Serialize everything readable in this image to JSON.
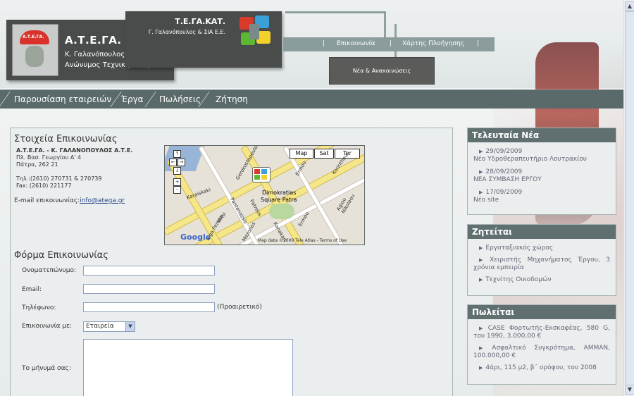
{
  "header": {
    "logo_helmet": "Α.Τ.Ε.ΓΑ.",
    "logo_title": "Α.Τ.Ε.ΓΑ.",
    "logo_sub1": "Κ. Γαλανόπουλος Α.Τ.Ε.",
    "logo_sub2": "Ανώνυμος Τεχνική Εταιρεία",
    "tega_title": "Τ.Ε.ΓΑ.ΚΑΤ.",
    "tega_sub": "Γ. Γαλανόπουλος & ΣΙΑ Ε.Ε.",
    "topnav": [
      "|",
      "Επικοινωνία",
      "|",
      "Χάρτης Πλοήγησης",
      "|"
    ],
    "news_button": "Νέα & Ανακοινώσεις"
  },
  "mainnav": [
    "Παρουσίαση εταιρειών",
    "Έργα",
    "Πωλήσεις",
    "Ζήτηση"
  ],
  "contact": {
    "heading": "Στοιχεία Επικοινωνίας",
    "company": "Α.Τ.Ε.ΓΑ. - Κ. ΓΑΛΑΝΟΠΟΥΛΟΣ Α.Τ.Ε.",
    "address1": "Πλ. Βασ. Γεωργίου Α' 4",
    "address2": "Πάτρα, 262 21",
    "phone": "Τηλ.:(2610) 270731 & 270739",
    "fax": "Fax: (2610) 221177",
    "email_label": "E-mail επικοινωνίας:",
    "email": "info@atega.gr"
  },
  "map": {
    "buttons": [
      "Map",
      "Sat",
      "Ter"
    ],
    "controls": [
      "↑",
      "←",
      "→",
      "↓",
      "+",
      "–"
    ],
    "place_label1": "Dimokratias",
    "place_label2": "Square Patra",
    "streets": [
      "Gerokostopoulou",
      "Ermou",
      "Korinthou",
      "Agiou Nikolaou",
      "Pantanassis",
      "Mezonos",
      "Votsi",
      "Ermou",
      "Riga Fereou",
      "Patreos",
      "Kanakari",
      "Karaiskaki"
    ],
    "google": "Google",
    "credit": "Map data ©2009 Tele Atlas - Terms of Use"
  },
  "form": {
    "heading": "Φόρμα Επικοινωνίας",
    "name_label": "Ονοματεπώνυμο:",
    "email_label": "Email:",
    "phone_label": "Τηλέφωνο:",
    "phone_note": "(Προαιρετικό)",
    "contact_with_label": "Επικοινωνία με:",
    "contact_with_value": "Εταιρεία",
    "message_label": "Το μήνυμά σας:"
  },
  "sidebar": {
    "news": {
      "title": "Τελευταία Νέα",
      "items": [
        {
          "date": "29/09/2009",
          "text": "Νέο Υδροθεραπευτήριο Λουτρακίου"
        },
        {
          "date": "28/09/2009",
          "text": "ΝΕΑ ΣΥΜΒΑΣΗ ΕΡΓΟΥ"
        },
        {
          "date": "17/09/2009",
          "text": "Νέο site"
        }
      ]
    },
    "wanted": {
      "title": "Ζητείται",
      "items": [
        "Εργοταξιακός χώρος",
        "Χειριστής Μηχανήματος Έργου, 3 χρόνια εμπειρία",
        "Τεχνίτης Οικοδομών"
      ]
    },
    "forsale": {
      "title": "Πωλείται",
      "items": [
        "CASE Φορτωτής-Εκσκαφέας, 580 G, του 1990, 3.000,00 €",
        "Ασφαλτικό Συγκρότημα, AMMAN, 100.000,00 €",
        "4άρι, 115 μ2, β΄ ορόφου, του 2008"
      ]
    }
  },
  "colors": {
    "header_dark": "#4a4c4c",
    "nav": "#5a6a6a",
    "sidebar_head": "#607070",
    "link": "#2a4a8a"
  }
}
